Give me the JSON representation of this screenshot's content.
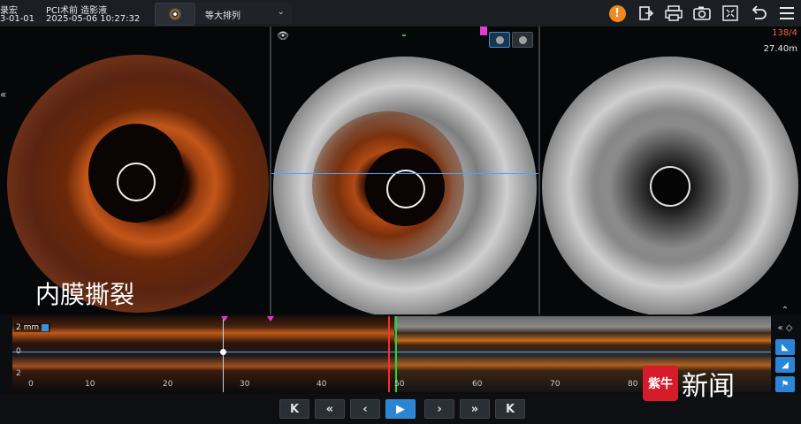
{
  "header": {
    "patient_name": "录宏",
    "patient_dob": "3-01-01",
    "stage": "PCI术前 造影液",
    "datetime": "2025-05-06 10:27:32",
    "layout_option": "等大排列",
    "icons": [
      "alert-icon",
      "export-icon",
      "print-icon",
      "camera-icon",
      "fullscreen-icon",
      "undo-icon",
      "menu-icon"
    ]
  },
  "viewer": {
    "overlay_label": "内膜撕裂",
    "frame_readout": "138/4",
    "length_readout": "27.40m"
  },
  "longview": {
    "scale_unit": "2 mm",
    "depth_labels": [
      "0",
      "2"
    ],
    "ticks": [
      "0",
      "10",
      "20",
      "30",
      "40",
      "50",
      "60",
      "70",
      "80"
    ]
  },
  "playback": {
    "buttons": [
      "K",
      "«",
      "‹",
      "▶",
      "›",
      "»",
      "K"
    ]
  },
  "watermark": {
    "badge": "紫牛",
    "text": "新闻"
  },
  "colors": {
    "accent": "#2a86d4",
    "alert": "#f08a1c",
    "cursor_red": "#ff2d2d",
    "cursor_green": "#25d23c"
  }
}
